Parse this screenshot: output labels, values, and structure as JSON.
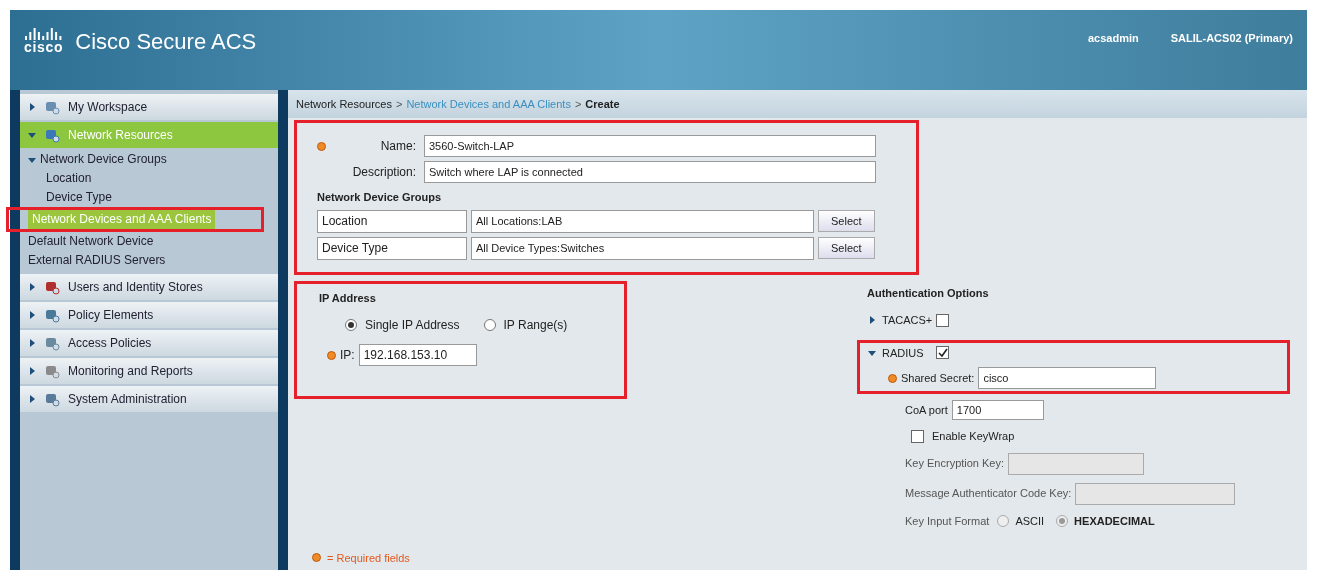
{
  "header": {
    "logo": "cisco",
    "title": "Cisco Secure ACS",
    "user": "acsadmin",
    "server": "SALIL-ACS02 (Primary)"
  },
  "sidebar": {
    "drawers": [
      {
        "label": "My Workspace",
        "selected": false,
        "expanded": false
      },
      {
        "label": "Network Resources",
        "selected": true,
        "expanded": true,
        "children": [
          {
            "label": "Network Device Groups",
            "selected": false,
            "highlighted": false,
            "expanded": true,
            "children": [
              {
                "label": "Location",
                "selected": false,
                "highlighted": false
              },
              {
                "label": "Device Type",
                "selected": false,
                "highlighted": false
              }
            ]
          },
          {
            "label": "Network Devices and AAA Clients",
            "selected": true,
            "highlighted": true
          },
          {
            "label": "Default Network Device",
            "selected": false,
            "highlighted": false
          },
          {
            "label": "External RADIUS Servers",
            "selected": false,
            "highlighted": false
          }
        ]
      },
      {
        "label": "Users and Identity Stores",
        "selected": false,
        "expanded": false
      },
      {
        "label": "Policy Elements",
        "selected": false,
        "expanded": false
      },
      {
        "label": "Access Policies",
        "selected": false,
        "expanded": false
      },
      {
        "label": "Monitoring and Reports",
        "selected": false,
        "expanded": false
      },
      {
        "label": "System Administration",
        "selected": false,
        "expanded": false
      }
    ]
  },
  "breadcrumb": [
    {
      "label": "Network Resources",
      "kind": "text"
    },
    {
      "label": ">",
      "kind": "separator"
    },
    {
      "label": "Network Devices and AAA Clients",
      "kind": "link"
    },
    {
      "label": ">",
      "kind": "separator"
    },
    {
      "label": "Create",
      "kind": "current"
    }
  ],
  "general": {
    "highlighted": true,
    "name": {
      "label": "Name:",
      "value": "3560-Switch-LAP",
      "required": true
    },
    "description": {
      "label": "Description:",
      "value": "Switch where LAP is connected",
      "required": false
    },
    "groups_heading": "Network Device Groups",
    "groups": [
      {
        "label": "Location",
        "value": "All Locations:LAB",
        "button": "Select"
      },
      {
        "label": "Device Type",
        "value": "All Device Types:Switches",
        "button": "Select"
      }
    ]
  },
  "ip": {
    "highlighted": true,
    "heading": "IP Address",
    "options": [
      {
        "label": "Single IP Address",
        "selected": true
      },
      {
        "label": "IP Range(s)",
        "selected": false
      }
    ],
    "field": {
      "label": "IP:",
      "value": "192.168.153.10",
      "required": true
    }
  },
  "auth": {
    "heading": "Authentication Options",
    "tacacs": {
      "label": "TACACS+",
      "expanded": false,
      "checked": false,
      "highlighted": false
    },
    "radius": {
      "label": "RADIUS",
      "expanded": true,
      "checked": true,
      "highlighted": true
    },
    "shared_secret": {
      "label": "Shared Secret:",
      "value": "cisco",
      "required": true
    },
    "coa_port": {
      "label": "CoA port",
      "value": "1700"
    },
    "keywrap": {
      "label": "Enable KeyWrap",
      "checked": false
    },
    "key_encryption": {
      "label": "Key Encryption Key:",
      "disabled": true
    },
    "mack": {
      "label": "Message Authenticator Code Key:",
      "disabled": true
    },
    "key_format": {
      "label": "Key Input Format",
      "disabled": true,
      "options": [
        {
          "label": "ASCII",
          "selected": false
        },
        {
          "label": "HEXADECIMAL",
          "selected": true
        }
      ]
    }
  },
  "footer": {
    "note": "= Required fields"
  }
}
